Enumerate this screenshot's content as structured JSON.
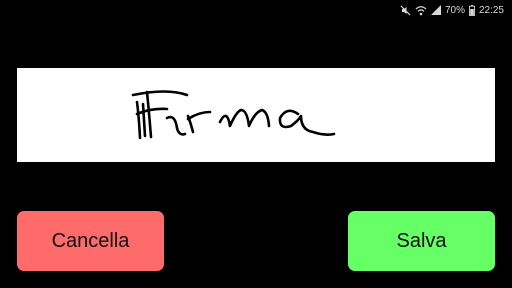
{
  "status_bar": {
    "battery_percent": "70%",
    "time": "22:25",
    "icons": [
      "mute-icon",
      "wifi-icon",
      "signal-icon",
      "battery-icon"
    ]
  },
  "signature_pad": {
    "signature_text": "Firma"
  },
  "buttons": {
    "cancel_label": "Cancella",
    "save_label": "Salva"
  },
  "colors": {
    "background": "#000000",
    "pad": "#ffffff",
    "cancel": "#ff6b6b",
    "save": "#66ff66",
    "ink": "#000000"
  }
}
